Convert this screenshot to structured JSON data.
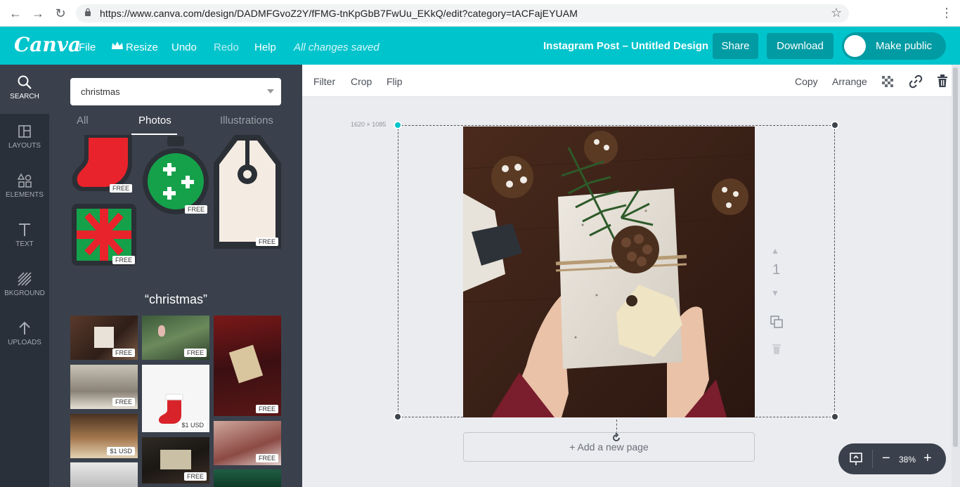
{
  "browser": {
    "url": "https://www.canva.com/design/DADMFGvoZ2Y/fFMG-tnKpGbB7FwUu_EKkQ/edit?category=tACFajEYUAM"
  },
  "header": {
    "logo": "Canva",
    "menu": [
      "File",
      "Resize",
      "Undo",
      "Redo",
      "Help"
    ],
    "saved_status": "All changes saved",
    "design_title": "Instagram Post – Untitled Design",
    "share": "Share",
    "download": "Download",
    "make_public": "Make public",
    "accent": "#00c4cc"
  },
  "rail": [
    {
      "label": "SEARCH",
      "icon": "search-icon"
    },
    {
      "label": "LAYOUTS",
      "icon": "layouts-icon"
    },
    {
      "label": "ELEMENTS",
      "icon": "elements-icon"
    },
    {
      "label": "TEXT",
      "icon": "text-icon"
    },
    {
      "label": "BKGROUND",
      "icon": "background-icon"
    },
    {
      "label": "UPLOADS",
      "icon": "uploads-icon"
    }
  ],
  "panel": {
    "search_value": "christmas",
    "tabs": [
      "All",
      "Photos",
      "Illustrations"
    ],
    "active_tab": "Photos",
    "section_title": "“christmas”",
    "illustration_badges": [
      "FREE",
      "FREE",
      "FREE",
      "FREE"
    ],
    "photo_badges": [
      "FREE",
      "FREE",
      "FREE",
      "FREE",
      "$1 USD",
      "$1 USD",
      "FREE",
      "FREE",
      "FREE"
    ]
  },
  "toolbar": {
    "left": [
      "Filter",
      "Crop",
      "Flip"
    ],
    "right": [
      "Copy",
      "Arrange"
    ]
  },
  "canvas": {
    "dimensions": "1620 × 1085",
    "add_page": "+ Add a new page",
    "page_number": "1"
  },
  "zoom": {
    "minus": "−",
    "value": "38%",
    "plus": "+"
  }
}
